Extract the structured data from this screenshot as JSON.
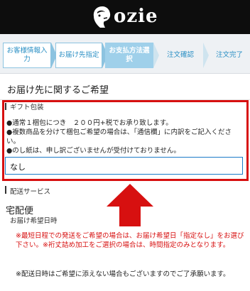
{
  "header": {
    "logo_text": "ozie"
  },
  "steps": [
    {
      "label": "お客様情報入力"
    },
    {
      "label": "お届け先指定"
    },
    {
      "label": "お支払方法選択"
    },
    {
      "label": "注文確認"
    },
    {
      "label": "注文完了"
    }
  ],
  "section": {
    "title": "お届け先に関するご希望"
  },
  "gift": {
    "label": "ギフト包装",
    "lines": [
      "●通常１梱包につき　２００円+税でお承り致します。",
      "●複数商品を分けて梱包ご希望の場合は、「通信欄」に内訳をご記入ください。",
      "●のし紙は、申し訳ございませんが受付けておりません。"
    ],
    "selected_value": "なし"
  },
  "shipping": {
    "label": "配送サービス",
    "type": "宅配便",
    "date_label": "お届け希望日時",
    "notice_red": "※最短日程での発送をご希望の場合は、お届け希望日「指定なし」をお選び下さい。※裄丈詰め加工をご選択の場合は、時間指定のみとなります。",
    "notice_black": "※配送日時はご希望に添えない場合もございますのでご了承願います。"
  },
  "colors": {
    "header_bg": "#0d0d0d",
    "step_active_bg": "#9fd0ea",
    "step_text": "#2a8fc4",
    "highlight_red": "#d71010",
    "input_border": "#1b7bc8"
  }
}
